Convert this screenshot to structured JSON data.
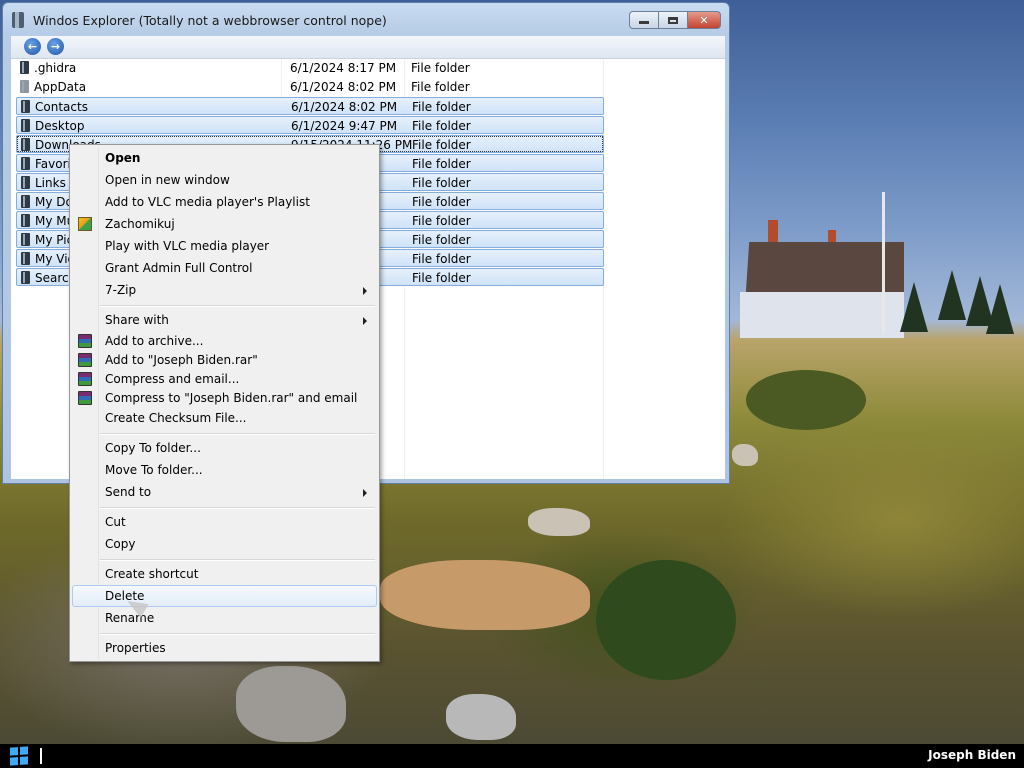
{
  "window": {
    "title": "Windos Explorer (Totally not a webbrowser control nope)",
    "minimize_icon": "minimize-icon",
    "maximize_icon": "maximize-icon",
    "close_glyph": "✕"
  },
  "nav": {
    "back_glyph": "←",
    "forward_glyph": "→"
  },
  "files": [
    {
      "name": ".ghidra",
      "date": "6/1/2024 8:17 PM",
      "type": "File folder",
      "selected": false
    },
    {
      "name": "AppData",
      "date": "6/1/2024 8:02 PM",
      "type": "File folder",
      "selected": false
    },
    {
      "name": "Contacts",
      "date": "6/1/2024 8:02 PM",
      "type": "File folder",
      "selected": true
    },
    {
      "name": "Desktop",
      "date": "6/1/2024 9:47 PM",
      "type": "File folder",
      "selected": true
    },
    {
      "name": "Downloads",
      "date": "9/15/2024 11:26 PM",
      "type": "File folder",
      "selected": true
    },
    {
      "name": "Favorites",
      "date": "",
      "type": "File folder",
      "selected": true
    },
    {
      "name": "Links",
      "date": "",
      "type": "File folder",
      "selected": true
    },
    {
      "name": "My Documents",
      "date": "",
      "type": "File folder",
      "selected": true
    },
    {
      "name": "My Music",
      "date": "",
      "type": "File folder",
      "selected": true
    },
    {
      "name": "My Pictures",
      "date": "",
      "type": "File folder",
      "selected": true
    },
    {
      "name": "My Videos",
      "date": "",
      "type": "File folder",
      "selected": true
    },
    {
      "name": "Searches",
      "date": "",
      "type": "File folder",
      "selected": true
    }
  ],
  "context_menu": {
    "open": "Open",
    "open_new_window": "Open in new window",
    "add_vlc_playlist": "Add to VLC media player's Playlist",
    "zachomikuj": "Zachomikuj",
    "play_vlc": "Play with VLC media player",
    "grant_admin": "Grant Admin Full Control",
    "seven_zip": "7-Zip",
    "share_with": "Share with",
    "add_archive": "Add to archive...",
    "add_rar": "Add to \"Joseph Biden.rar\"",
    "compress_email": "Compress and email...",
    "compress_rar_email": "Compress to \"Joseph Biden.rar\" and email",
    "create_checksum": "Create Checksum File...",
    "copy_to_folder": "Copy To folder...",
    "move_to_folder": "Move To folder...",
    "send_to": "Send to",
    "cut": "Cut",
    "copy": "Copy",
    "create_shortcut": "Create shortcut",
    "delete": "Delete",
    "rename": "Rename",
    "properties": "Properties"
  },
  "taskbar": {
    "user": "Joseph Biden"
  }
}
